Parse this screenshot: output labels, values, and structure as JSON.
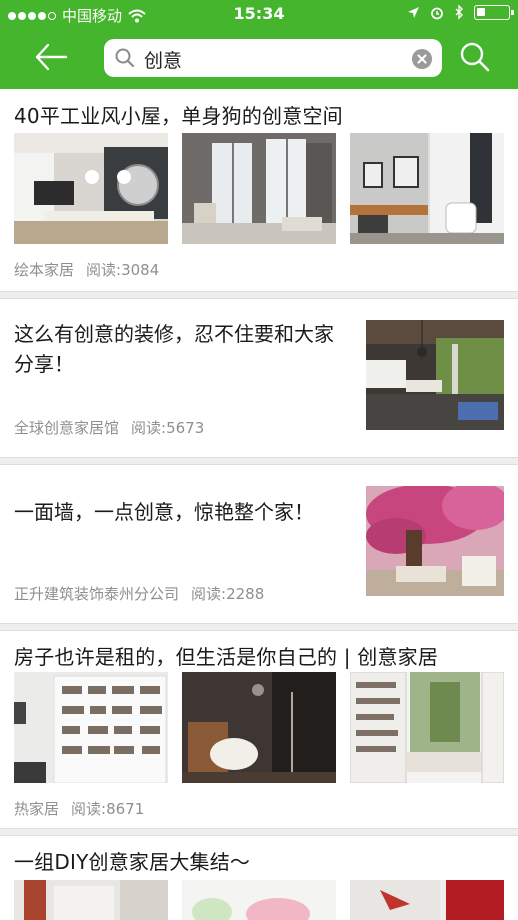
{
  "status_bar": {
    "carrier": "中国移动",
    "time": "15:34",
    "signal_bars": 4,
    "battery_level": 0.25
  },
  "nav": {
    "back_icon": "arrow-left-icon",
    "search_query": "创意",
    "clear_icon": "clear-x-icon",
    "search_icon": "search-icon"
  },
  "colors": {
    "nav_green": "#44b52d",
    "meta_gray": "#8f8f8f",
    "divider": "#eeeeee"
  },
  "articles": [
    {
      "title": "40平工业风小屋，单身狗的创意空间",
      "source": "绘本家居",
      "reads": "阅读:3084",
      "layout": "three-images"
    },
    {
      "title": "这么有创意的装修，忍不住要和大家分享！",
      "source": "全球创意家居馆",
      "reads": "阅读:5673",
      "layout": "single-image"
    },
    {
      "title": "一面墙，一点创意，惊艳整个家！",
      "source": "正升建筑装饰泰州分公司",
      "reads": "阅读:2288",
      "layout": "single-image"
    },
    {
      "title": "房子也许是租的，但生活是你自己的 | 创意家居",
      "source": "热家居",
      "reads": "阅读:8671",
      "layout": "three-images"
    },
    {
      "title": "一组DIY创意家居大集结～",
      "source": "",
      "reads": "",
      "layout": "three-images"
    }
  ]
}
